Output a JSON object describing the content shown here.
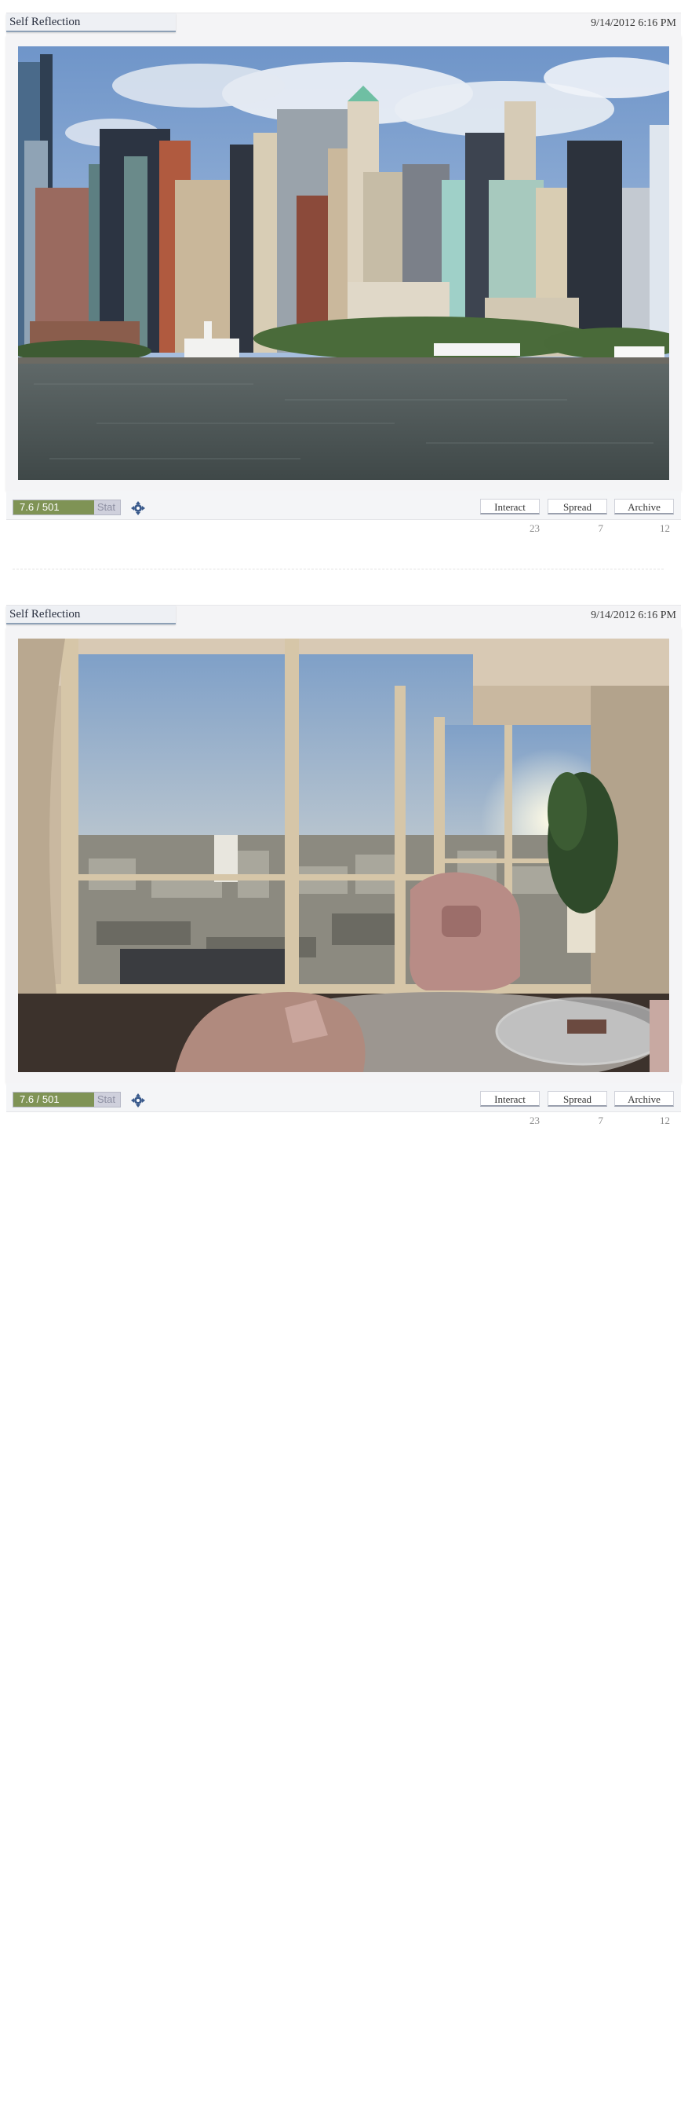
{
  "posts": [
    {
      "title": "Self Reflection",
      "timestamp": "9/14/2012 6:16 PM",
      "photo_subject": "city-skyline-waterfront",
      "rating": {
        "text": "7.6 / 501",
        "stat_label": "Stat",
        "fill_percent": 76
      },
      "actions": [
        {
          "label": "Interact",
          "count": "23"
        },
        {
          "label": "Spread",
          "count": "7"
        },
        {
          "label": "Archive",
          "count": "12"
        }
      ]
    },
    {
      "title": "Self Reflection",
      "timestamp": "9/14/2012 6:16 PM",
      "photo_subject": "penthouse-living-room-city-view",
      "rating": {
        "text": "7.6 / 501",
        "stat_label": "Stat",
        "fill_percent": 76
      },
      "actions": [
        {
          "label": "Interact",
          "count": "23"
        },
        {
          "label": "Spread",
          "count": "7"
        },
        {
          "label": "Archive",
          "count": "12"
        }
      ]
    }
  ],
  "icons": {
    "expand": "expand-arrows-icon"
  },
  "colors": {
    "rating_fill": "#7f9355",
    "rating_track": "#cfd0dc",
    "header_bg": "#f4f4f6",
    "title_underline": "#8da0b6",
    "icon_blue": "#3a5a8c"
  }
}
